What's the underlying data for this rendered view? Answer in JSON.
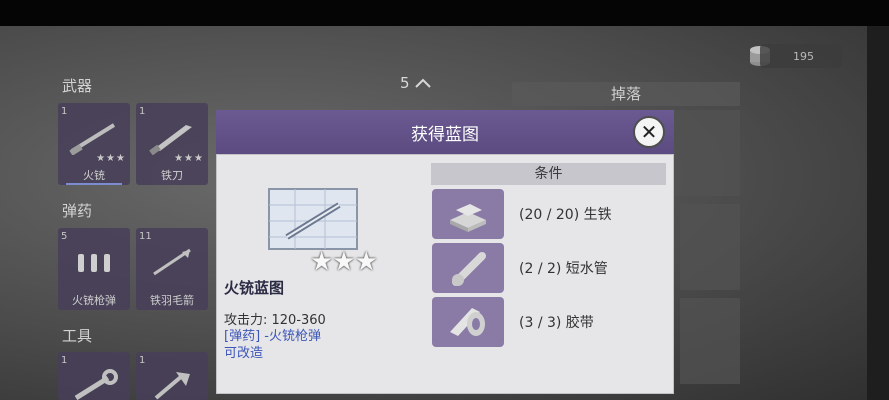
{
  "currency": {
    "amount": "195"
  },
  "left_panel": {
    "weapons_label": "武器",
    "weapons_count": "5",
    "ammo_label": "弹药",
    "tools_label": "工具",
    "weapon_slots": [
      {
        "count": "1",
        "name": "火铳",
        "stars": "★★★"
      },
      {
        "count": "1",
        "name": "铁刀",
        "stars": "★★★"
      }
    ],
    "ammo_slots": [
      {
        "count": "5",
        "name": "火铳枪弹"
      },
      {
        "count": "11",
        "name": "铁羽毛箭"
      }
    ],
    "tool_slots": [
      {
        "count": "1"
      },
      {
        "count": "1"
      }
    ]
  },
  "right_panel": {
    "header": "掉落"
  },
  "modal": {
    "title": "获得蓝图",
    "blueprint_name": "火铳蓝图",
    "stars": "★★★",
    "attack": "攻击力: 120-360",
    "ammo": "[弹药] -火铳枪弹",
    "modifiable": "可改造",
    "conditions_header": "条件",
    "conditions": [
      {
        "text": "(20 / 20) 生铁",
        "icon": "iron-ingot-icon"
      },
      {
        "text": "(2 / 2) 短水管",
        "icon": "pipe-icon"
      },
      {
        "text": "(3 / 3) 胶带",
        "icon": "tape-icon"
      }
    ]
  },
  "colors": {
    "modal_header": "#5f4f86",
    "slot_bg": "#463e58",
    "link_blue": "#3d57b8",
    "condition_icon_bg": "#8a7ba6"
  }
}
